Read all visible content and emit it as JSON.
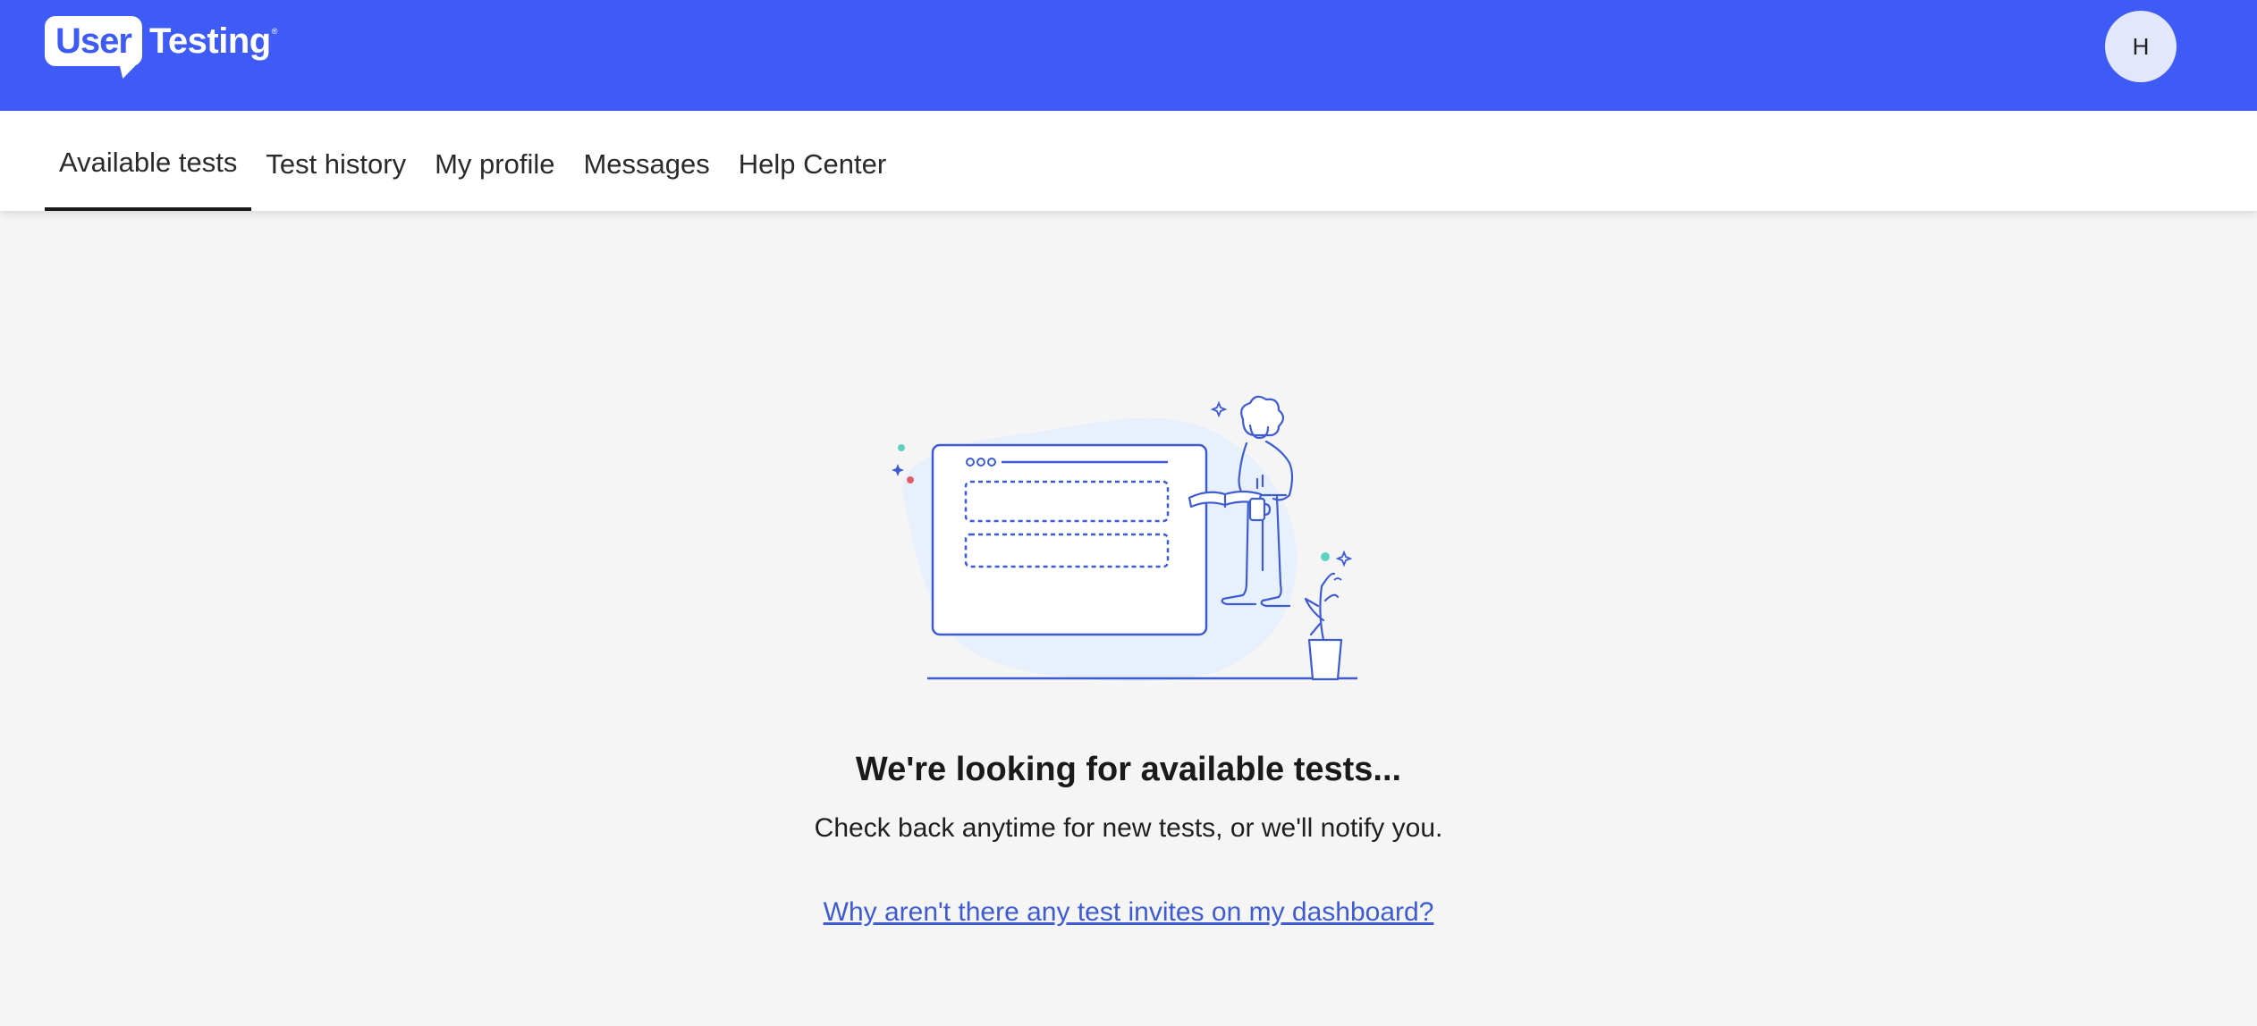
{
  "header": {
    "logo_box_text": "User",
    "logo_text": "Testing",
    "logo_reg": "®",
    "avatar_initial": "H",
    "brand_color": "#3e5cf5"
  },
  "nav": {
    "tabs": [
      {
        "label": "Available tests",
        "active": true
      },
      {
        "label": "Test history",
        "active": false
      },
      {
        "label": "My profile",
        "active": false
      },
      {
        "label": "Messages",
        "active": false
      },
      {
        "label": "Help Center",
        "active": false
      }
    ]
  },
  "main": {
    "illustration_icon": "person-with-browser-window-illustration",
    "headline": "We're looking for available tests...",
    "subtext": "Check back anytime for new tests, or we'll notify you.",
    "help_link": "Why aren't there any test invites on my dashboard?"
  }
}
